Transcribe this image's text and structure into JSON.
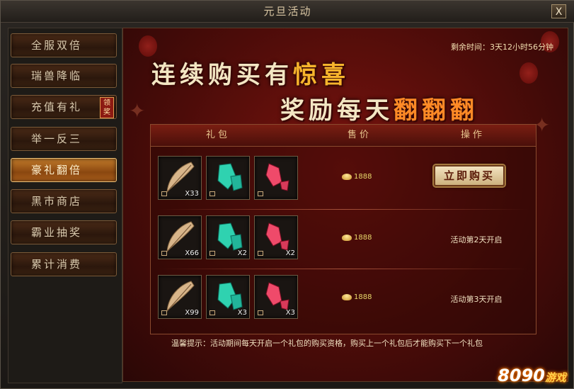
{
  "window": {
    "title": "元旦活动",
    "close_label": "X"
  },
  "sidebar": {
    "items": [
      {
        "label": "全服双倍"
      },
      {
        "label": "瑞兽降临"
      },
      {
        "label": "充值有礼",
        "badge": "领奖"
      },
      {
        "label": "举一反三"
      },
      {
        "label": "豪礼翻倍",
        "active": true
      },
      {
        "label": "黑市商店"
      },
      {
        "label": "霸业抽奖"
      },
      {
        "label": "累计消费"
      }
    ]
  },
  "main": {
    "timer": "剩余时间：3天12小时56分钟",
    "slogan_line1_a": "连续购买有",
    "slogan_line1_b": "惊喜",
    "slogan_line2_a": "奖励每天",
    "slogan_line2_b": "翻翻翻",
    "table": {
      "headers": [
        "礼包",
        "售价",
        "操作"
      ],
      "rows": [
        {
          "items": [
            {
              "icon": "feather-icon",
              "count": "X33"
            },
            {
              "icon": "green-crystal-icon",
              "count": ""
            },
            {
              "icon": "red-crystal-icon",
              "count": ""
            }
          ],
          "price": "1888",
          "action": "立即购买",
          "action_type": "button"
        },
        {
          "items": [
            {
              "icon": "feather-icon",
              "count": "X66"
            },
            {
              "icon": "green-crystal-icon",
              "count": "X2"
            },
            {
              "icon": "red-crystal-icon",
              "count": "X2"
            }
          ],
          "price": "1888",
          "action": "活动第2天开启",
          "action_type": "text"
        },
        {
          "items": [
            {
              "icon": "feather-icon",
              "count": "X99"
            },
            {
              "icon": "green-crystal-icon",
              "count": "X3"
            },
            {
              "icon": "red-crystal-icon",
              "count": "X3"
            }
          ],
          "price": "1888",
          "action": "活动第3天开启",
          "action_type": "text"
        }
      ]
    },
    "tip": "温馨提示：活动期间每天开启一个礼包的购买资格，购买上一个礼包后才能购买下一个礼包"
  },
  "watermark": {
    "number": "8090",
    "cn": "游戏"
  },
  "colors": {
    "accent_gold": "#f7b52c",
    "panel_red": "#7a130e",
    "active_tab": "#c27b2a"
  }
}
